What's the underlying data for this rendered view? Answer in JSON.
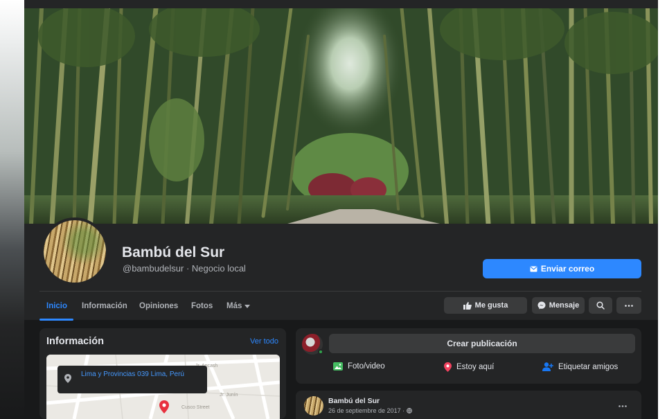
{
  "page": {
    "name": "Bambú del Sur",
    "handle": "@bambudelsur · Negocio local",
    "primary_action": "Enviar correo"
  },
  "tabs": [
    {
      "label": "Inicio",
      "active": true
    },
    {
      "label": "Información",
      "active": false
    },
    {
      "label": "Opiniones",
      "active": false
    },
    {
      "label": "Fotos",
      "active": false
    },
    {
      "label": "Más",
      "active": false
    }
  ],
  "actions": {
    "like": "Me gusta",
    "message": "Mensaje"
  },
  "info": {
    "title": "Información",
    "see_all": "Ver todo",
    "address": "Lima y Provincias 039 Lima, Perú"
  },
  "composer": {
    "placeholder": "Crear publicación",
    "photo": "Foto/video",
    "checkin": "Estoy aquí",
    "tag": "Etiquetar amigos"
  },
  "post": {
    "author": "Bambú del Sur",
    "date": "26 de septiembre de 2017 · "
  },
  "icons": {
    "email": "envelope-icon",
    "like": "thumbs-up-icon",
    "message": "messenger-icon",
    "search": "search-icon",
    "more": "ellipsis-icon",
    "dropdown": "caret-down-icon",
    "photo": "photo-icon",
    "checkin": "location-pin-icon",
    "tag": "tag-friends-icon",
    "privacy": "globe-icon"
  },
  "colors": {
    "accent": "#2d88ff",
    "surface": "#242526",
    "background": "#18191a",
    "button": "#3a3b3c",
    "photo_icon": "#45bd62",
    "pin_icon": "#f3425f",
    "tag_icon": "#1877f2"
  }
}
